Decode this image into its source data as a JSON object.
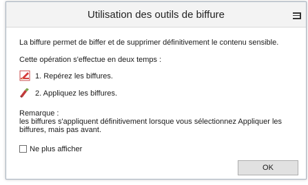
{
  "dialog": {
    "title": "Utilisation des outils de biffure",
    "intro": "La biffure permet de biffer et de supprimer définitivement le contenu sensible.",
    "steps_header": "Cette opération s'effectue en deux temps :",
    "steps": [
      {
        "icon": "red-pencil-icon",
        "label": "1. Repérez les biffures."
      },
      {
        "icon": "eraser-icon",
        "label": "2. Appliquez les biffures."
      }
    ],
    "note_title": "Remarque :",
    "note_line1": "les biffures s'appliquent définitivement lorsque vous sélectionnez Appliquer les",
    "note_line2": "biffures, mais pas avant.",
    "checkbox_label": "Ne plus afficher",
    "checkbox_checked": false,
    "ok_label": "OK"
  }
}
